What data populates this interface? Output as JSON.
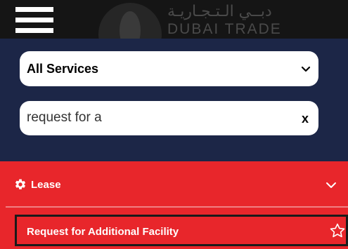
{
  "header": {
    "logo_arabic": "دبــي الـتـجـاريـة",
    "logo_english": "DUBAI TRADE",
    "menu_icon": "hamburger-menu-icon"
  },
  "filters": {
    "category_select": {
      "selected": "All Services",
      "options": [
        "All Services"
      ]
    },
    "search": {
      "value": "request for a",
      "clear_label": "x"
    }
  },
  "results": {
    "group": {
      "label": "Lease",
      "icon": "gear-icon",
      "expand_icon": "chevron-down-icon"
    },
    "items": [
      {
        "label": "Request for Additional Facility",
        "icon": "star-icon"
      }
    ]
  },
  "colors": {
    "header_bg": "#151515",
    "navy": "#1c2647",
    "red": "#e8262b",
    "white": "#ffffff"
  }
}
